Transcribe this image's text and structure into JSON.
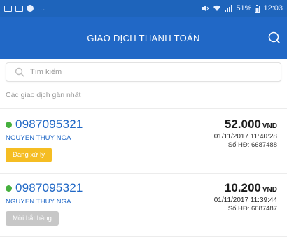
{
  "status_bar": {
    "right_text": "51%",
    "time": "12:03"
  },
  "header": {
    "title": "GIAO DỊCH THANH TOÁN"
  },
  "search": {
    "placeholder": "Tìm kiếm"
  },
  "section": {
    "title": "Các giao dịch gần nhất"
  },
  "transactions": [
    {
      "phone": "0987095321",
      "name": "NGUYEN THUY NGA",
      "status": "Đang xử lý",
      "amount": "52.000",
      "currency": "VND",
      "datetime": "01/11/2017 11:40:28",
      "invoice": "Số HĐ: 6687488"
    },
    {
      "phone": "0987095321",
      "name": "NGUYEN THUY NGA",
      "status": "Mời bắt hàng",
      "amount": "10.200",
      "currency": "VND",
      "datetime": "01/11/2017 11:39:44",
      "invoice": "Số HĐ: 6687487"
    }
  ],
  "colors": {
    "primary": "#2168c6",
    "status_online": "#46b03e",
    "badge_pending": "#f5bd23",
    "badge_failed": "#c7c7c7"
  },
  "icons": {
    "search": "search-icon",
    "header_action": "chat-icon",
    "online": "online-dot-icon"
  }
}
